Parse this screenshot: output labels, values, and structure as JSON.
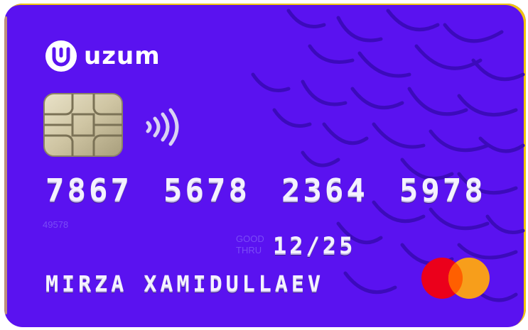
{
  "brand": {
    "name": "uzum",
    "icon": "uzum-logo-icon"
  },
  "card": {
    "number_groups": [
      "7867",
      "5678",
      "2364",
      "5978"
    ],
    "small_code": "49578",
    "good_thru_label_line1": "GOOD",
    "good_thru_label_line2": "THRU",
    "expiry": "12/25",
    "holder_name": "MIRZA XAMIDULLAEV",
    "network_icon": "mastercard-logo-icon",
    "chip_icon": "emv-chip-icon",
    "contactless_icon": "contactless-icon"
  },
  "colors": {
    "card_background": "#5a12f0",
    "pattern": "#3b0bb8",
    "mastercard_red": "#eb001b",
    "mastercard_orange": "#f79e1b",
    "mastercard_overlap": "#ff5f00"
  }
}
